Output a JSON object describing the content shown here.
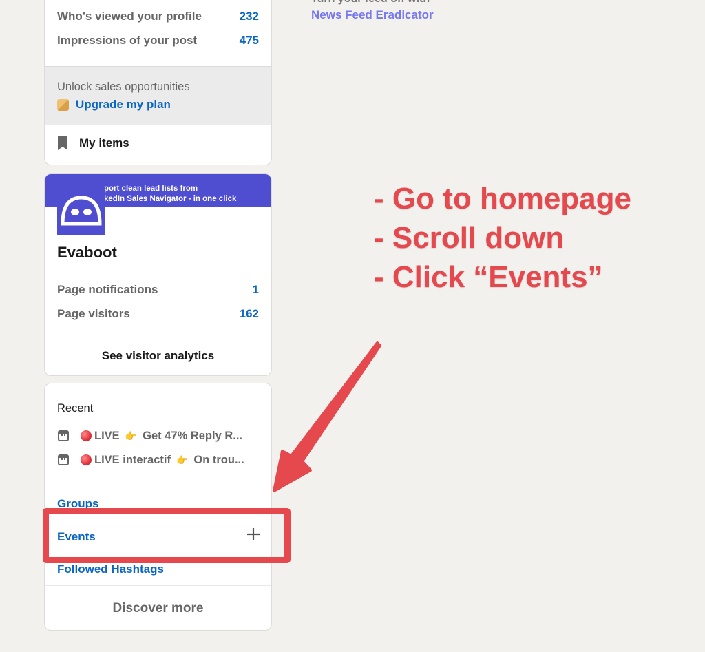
{
  "profile_stats": {
    "items": [
      {
        "label": "Who's viewed your profile",
        "value": "232"
      },
      {
        "label": "Impressions of your post",
        "value": "475"
      }
    ]
  },
  "premium": {
    "unlock_text": "Unlock sales opportunities",
    "upgrade_label": "Upgrade my plan",
    "icon": "premium-icon"
  },
  "my_items": {
    "label": "My items",
    "icon": "bookmark-icon"
  },
  "company_page": {
    "cover_tagline": [
      "port clean lead lists from",
      "kedIn Sales Navigator - in one click"
    ],
    "name": "Evaboot",
    "stats": [
      {
        "label": "Page notifications",
        "value": "1"
      },
      {
        "label": "Page visitors",
        "value": "162"
      }
    ],
    "analytics_label": "See visitor analytics",
    "brand_color": "#4f4ed0"
  },
  "recent": {
    "title": "Recent",
    "items": [
      {
        "prefix": "LIVE",
        "text": "Get 47% Reply R..."
      },
      {
        "prefix": "LIVE interactif",
        "text": "On trou..."
      }
    ],
    "links": {
      "groups": "Groups",
      "events": "Events",
      "followed_hashtags": "Followed Hashtags"
    },
    "discover_more": "Discover more"
  },
  "extension": {
    "partial_text": "Turn your feed off with",
    "link": "News Feed Eradicator"
  },
  "annotation": {
    "steps": [
      "- Go to homepage",
      "- Scroll down",
      "- Click “Events”"
    ],
    "color": "#e5484d"
  }
}
